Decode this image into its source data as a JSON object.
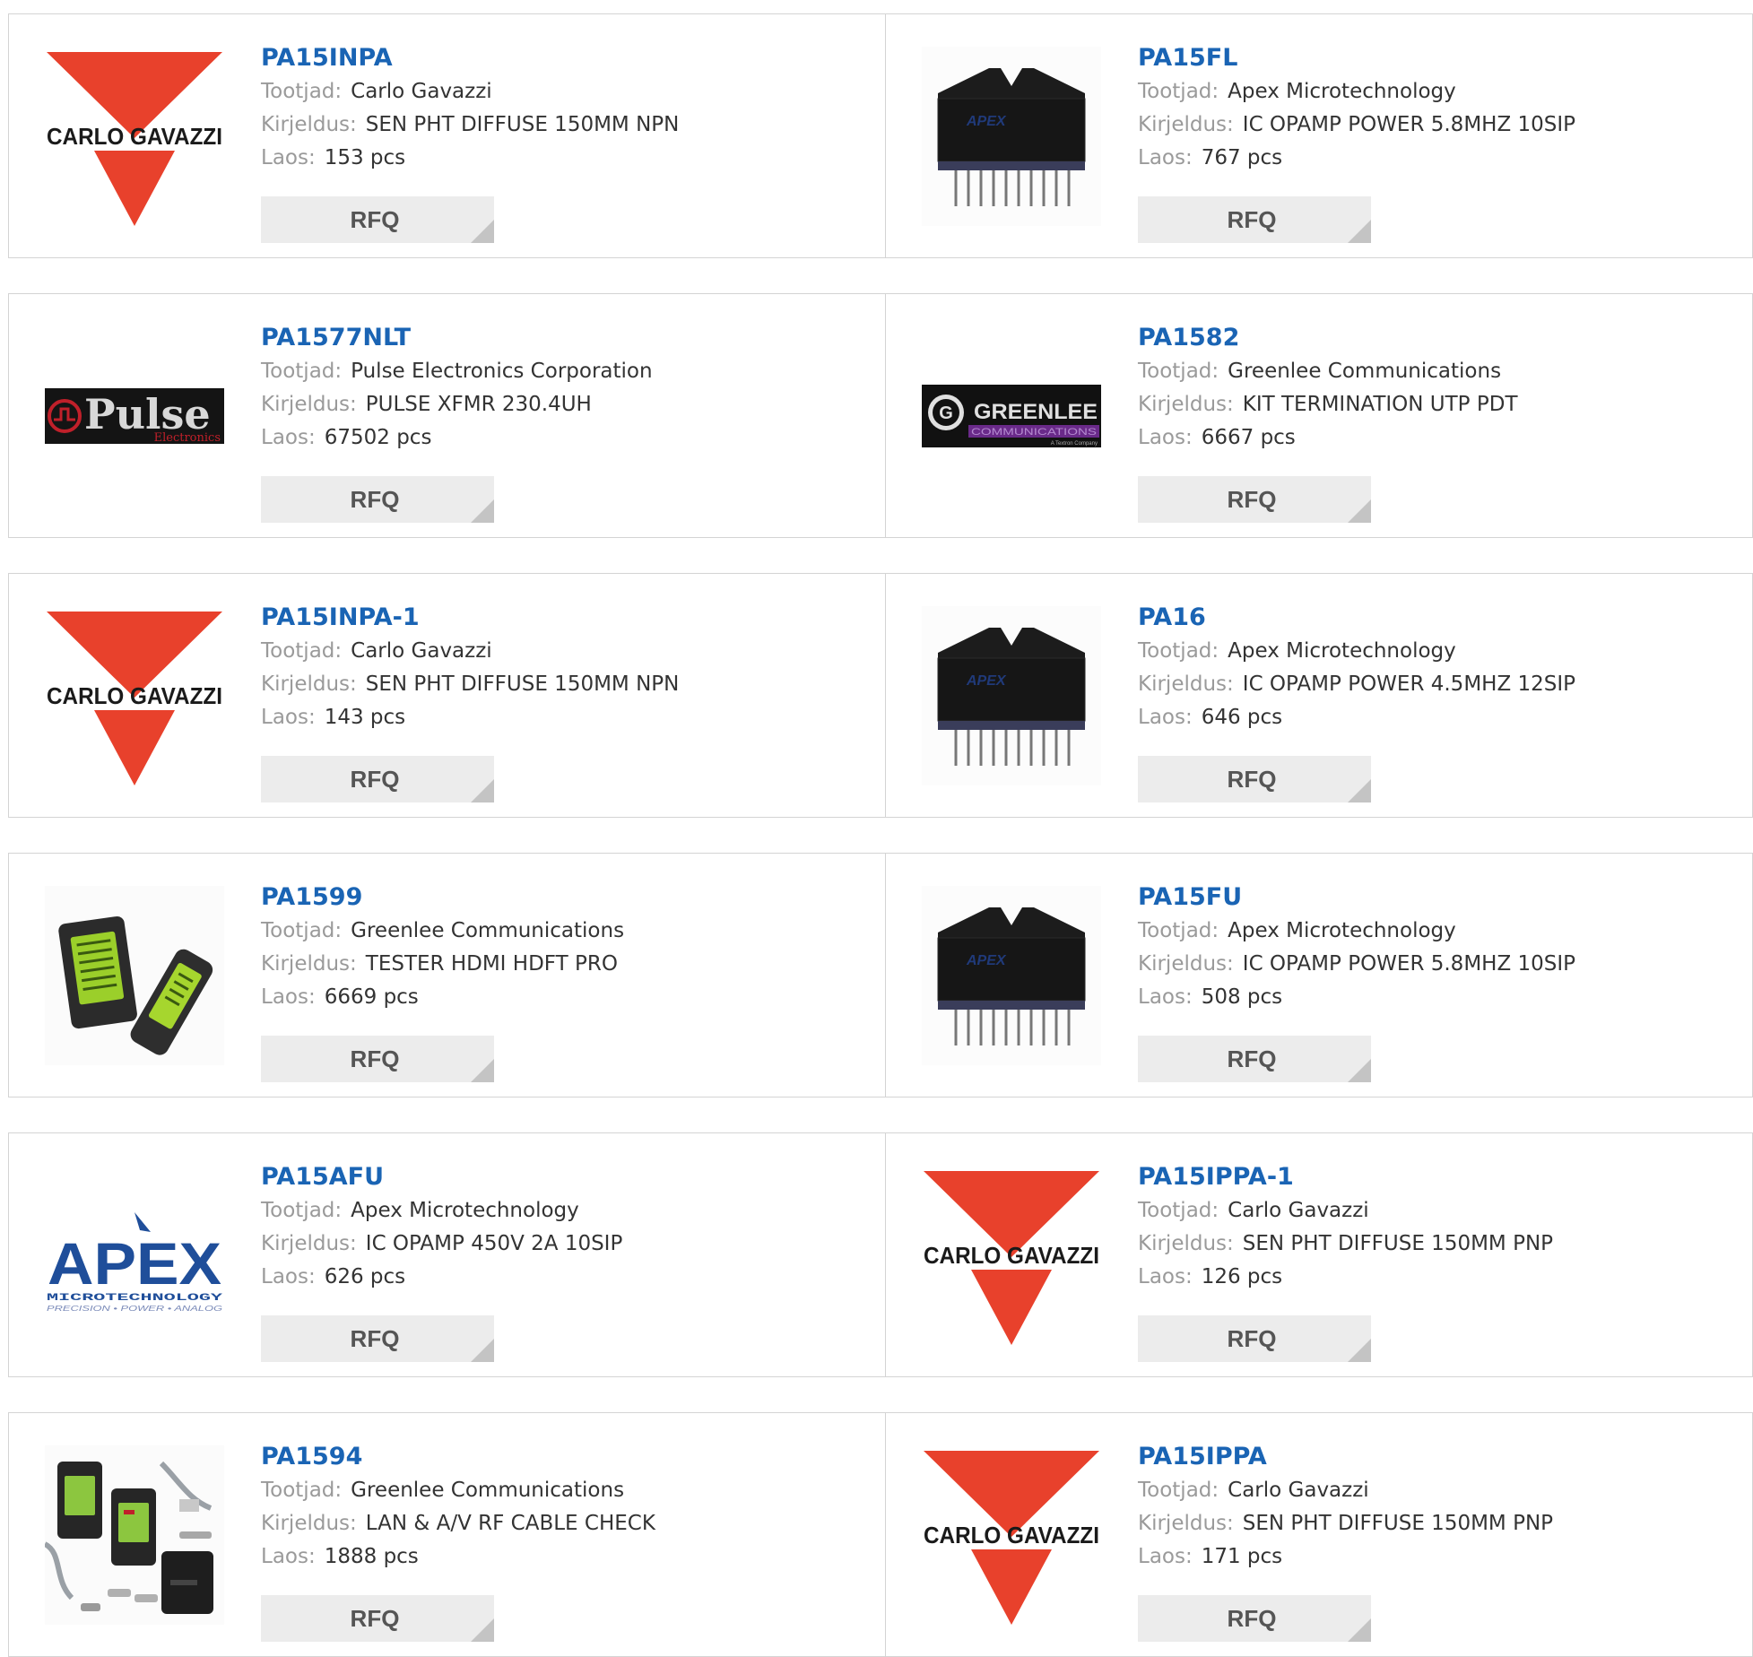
{
  "labels": {
    "manufacturer": "Tootjad:",
    "description": "Kirjeldus:",
    "stock": "Laos:",
    "rfq": "RFQ"
  },
  "logos": {
    "carlo": "CARLO GAVAZZI",
    "pulse_main": "Pulse",
    "pulse_sub": "Electronics",
    "greenlee_main": "GREENLEE",
    "greenlee_sub": "COMMUNICATIONS",
    "greenlee_tag": "A Textron Company",
    "apex_main": "APEX",
    "apex_sub": "MICROTECHNOLOGY",
    "apex_tag": "PRECISION • POWER • ANALOG",
    "chip_brand": "APEX"
  },
  "colors": {
    "link": "#1a64b4",
    "carlo_red": "#e8412c",
    "apex_blue": "#1f4e9a"
  },
  "products": [
    {
      "pn": "PA15INPA",
      "manufacturer": "Carlo Gavazzi",
      "description": "SEN PHT DIFFUSE 150MM NPN",
      "stock": "153 pcs",
      "image": "carlo-gavazzi-logo"
    },
    {
      "pn": "PA15FL",
      "manufacturer": "Apex Microtechnology",
      "description": "IC OPAMP POWER 5.8MHZ 10SIP",
      "stock": "767 pcs",
      "image": "sip-chip"
    },
    {
      "pn": "PA1577NLT",
      "manufacturer": "Pulse Electronics Corporation",
      "description": "PULSE XFMR 230.4UH",
      "stock": "67502 pcs",
      "image": "pulse-logo"
    },
    {
      "pn": "PA1582",
      "manufacturer": "Greenlee Communications",
      "description": "KIT TERMINATION UTP PDT",
      "stock": "6667 pcs",
      "image": "greenlee-logo"
    },
    {
      "pn": "PA15INPA-1",
      "manufacturer": "Carlo Gavazzi",
      "description": "SEN PHT DIFFUSE 150MM NPN",
      "stock": "143 pcs",
      "image": "carlo-gavazzi-logo"
    },
    {
      "pn": "PA16",
      "manufacturer": "Apex Microtechnology",
      "description": "IC OPAMP POWER 4.5MHZ 12SIP",
      "stock": "646 pcs",
      "image": "sip-chip"
    },
    {
      "pn": "PA1599",
      "manufacturer": "Greenlee Communications",
      "description": "TESTER HDMI HDFT PRO",
      "stock": "6669 pcs",
      "image": "hdmi-tester"
    },
    {
      "pn": "PA15FU",
      "manufacturer": "Apex Microtechnology",
      "description": "IC OPAMP POWER 5.8MHZ 10SIP",
      "stock": "508 pcs",
      "image": "sip-chip"
    },
    {
      "pn": "PA15AFU",
      "manufacturer": "Apex Microtechnology",
      "description": "IC OPAMP 450V 2A 10SIP",
      "stock": "626 pcs",
      "image": "apex-logo"
    },
    {
      "pn": "PA15IPPA-1",
      "manufacturer": "Carlo Gavazzi",
      "description": "SEN PHT DIFFUSE 150MM PNP",
      "stock": "126 pcs",
      "image": "carlo-gavazzi-logo"
    },
    {
      "pn": "PA1594",
      "manufacturer": "Greenlee Communications",
      "description": "LAN & A/V RF CABLE CHECK",
      "stock": "1888 pcs",
      "image": "cable-tester-kit"
    },
    {
      "pn": "PA15IPPA",
      "manufacturer": "Carlo Gavazzi",
      "description": "SEN PHT DIFFUSE 150MM PNP",
      "stock": "171 pcs",
      "image": "carlo-gavazzi-logo"
    }
  ]
}
